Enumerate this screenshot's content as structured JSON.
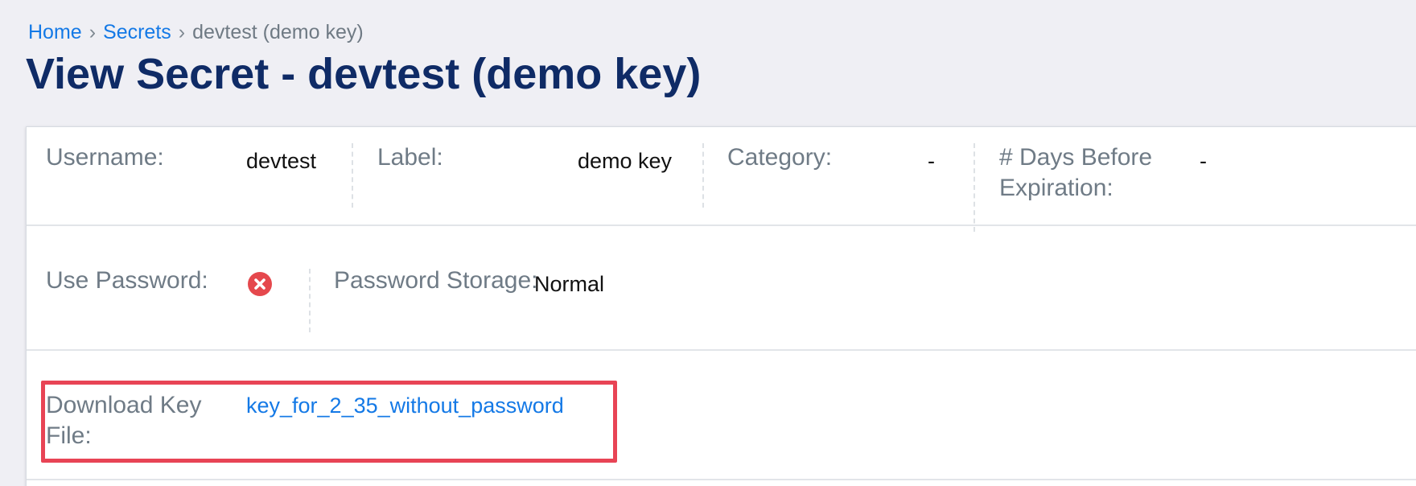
{
  "breadcrumb": {
    "items": [
      "Home",
      "Secrets",
      "devtest (demo key)"
    ],
    "separator": "›"
  },
  "page_title": "View Secret - devtest (demo key)",
  "details": {
    "username_label": "Username:",
    "username_value": "devtest",
    "label_label": "Label:",
    "label_value": "demo key",
    "category_label": "Category:",
    "category_value": "-",
    "days_before_expiration_label_line1": "# Days Before",
    "days_before_expiration_label_line2": "Expiration:",
    "days_before_expiration_value": "-",
    "use_password_label": "Use Password:",
    "use_password_icon": "x-circle-icon",
    "password_storage_label": "Password Storage:",
    "password_storage_value": "Normal",
    "download_key_file_label_line1": "Download Key",
    "download_key_file_label_line2": "File:",
    "download_key_file_link": "key_for_2_35_without_password"
  },
  "colors": {
    "link": "#1479e6",
    "title": "#0f2b66",
    "label": "#6f7b86",
    "error_icon": "#e5484d",
    "highlight": "#e84455"
  }
}
